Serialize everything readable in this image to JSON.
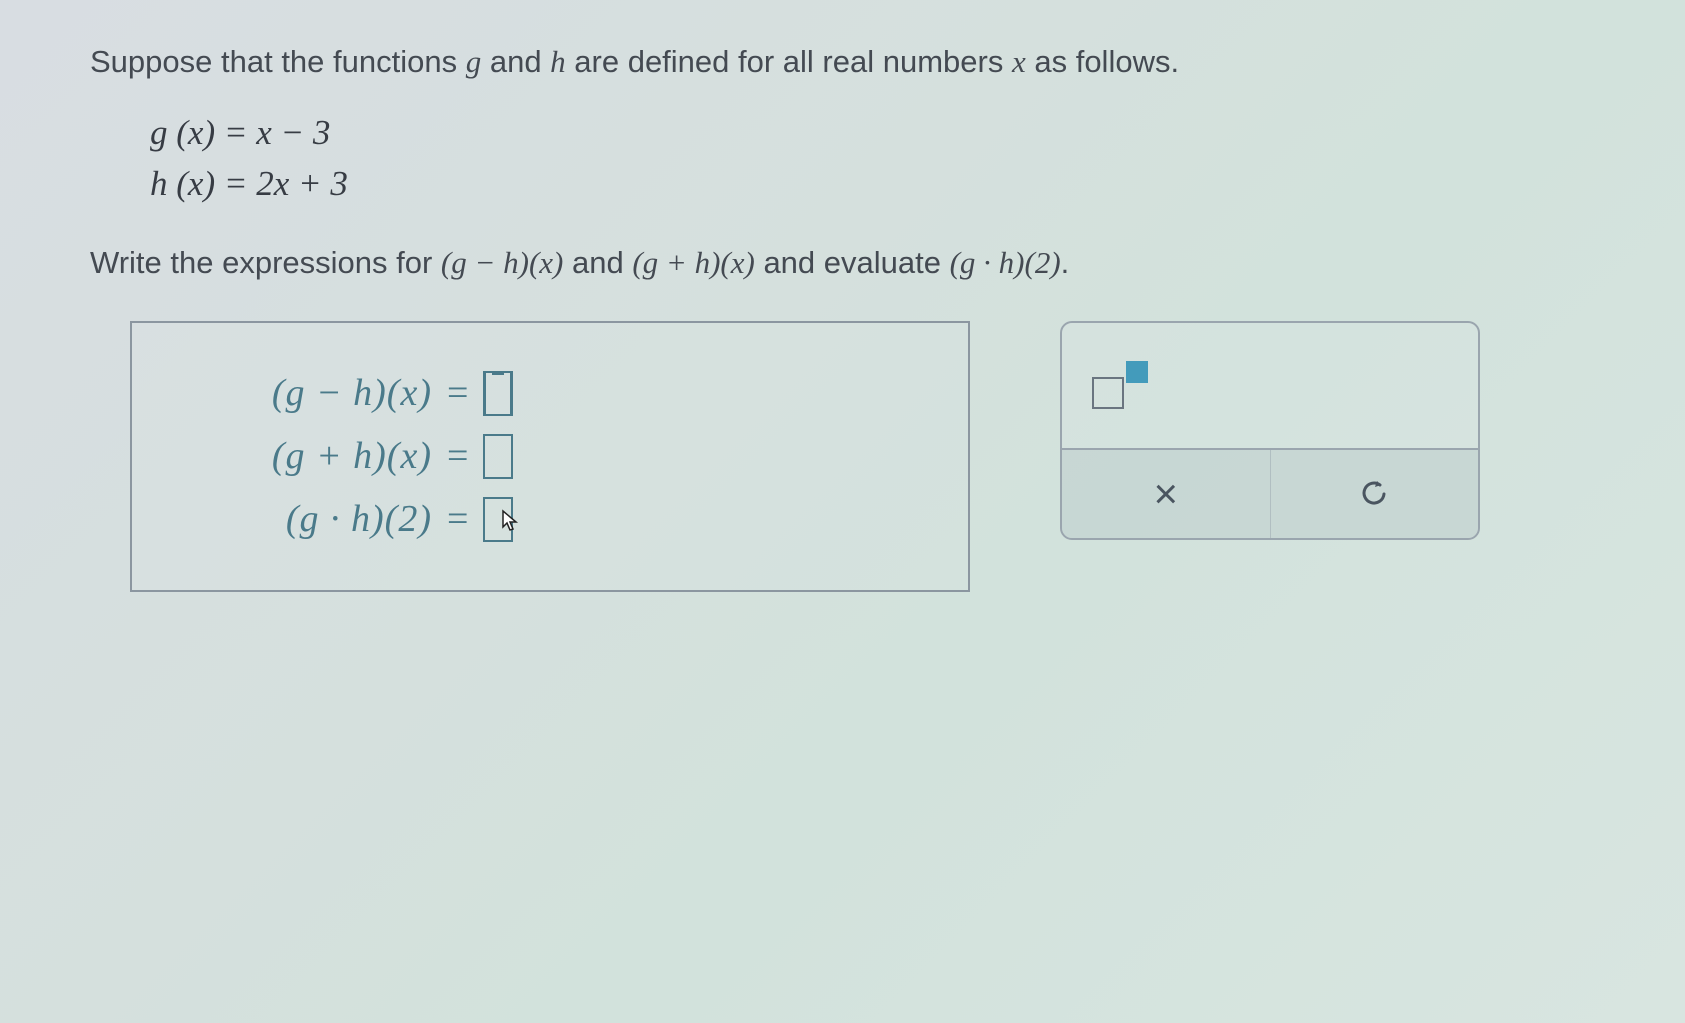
{
  "prompt": {
    "line1_a": "Suppose that the functions ",
    "line1_b": " and ",
    "line1_c": " are defined for all real numbers ",
    "line1_d": " as follows.",
    "g": "g",
    "h": "h",
    "x": "x"
  },
  "definitions": {
    "g_def": "g (x) = x − 3",
    "h_def": "h (x) = 2x + 3"
  },
  "instruction": {
    "a": "Write the expressions for ",
    "b": " and ",
    "c": " and evaluate ",
    "d": ".",
    "expr1": "(g − h)(x)",
    "expr2": "(g + h)(x)",
    "expr3": "(g · h)(2)"
  },
  "answers": {
    "row1_label": "(g − h)(x)",
    "row2_label": "(g + h)(x)",
    "row3_label": "(g · h)(2)",
    "equals": "="
  },
  "tools": {
    "clear_icon": "×",
    "reset_icon": "↺"
  }
}
